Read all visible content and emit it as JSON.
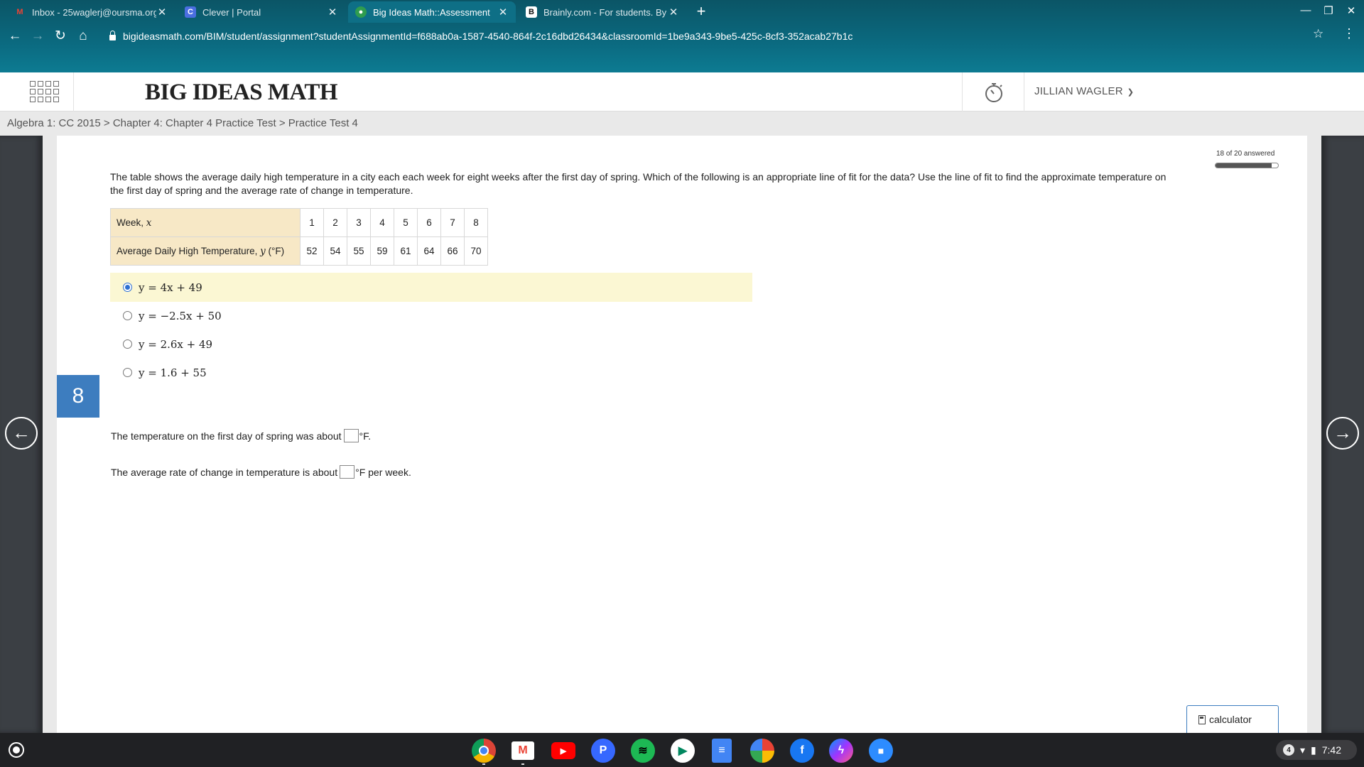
{
  "browser": {
    "tabs": [
      {
        "title": "Inbox - 25waglerj@oursma.org",
        "favicon": "gmail-icon"
      },
      {
        "title": "Clever | Portal",
        "favicon": "clever-icon"
      },
      {
        "title": "Big Ideas Math::Assessment",
        "favicon": "bigideas-icon",
        "active": true
      },
      {
        "title": "Brainly.com - For students. By st",
        "favicon": "brainly-icon"
      }
    ],
    "url": "bigideasmath.com/BIM/student/assignment?studentAssignmentId=f688ab0a-1587-4540-864f-2c16dbd26434&classroomId=1be9a343-9be5-425c-8cf3-352acab27b1c"
  },
  "header": {
    "logo": "BIG IDEAS MATH",
    "user": "JILLIAN WAGLER"
  },
  "breadcrumb": "Algebra 1: CC 2015 > Chapter 4: Chapter 4 Practice Test > Practice Test 4",
  "progress": {
    "label": "18 of 20 answered",
    "answered": 18,
    "total": 20
  },
  "question": {
    "number": "8",
    "text": "The table shows the average daily high temperature in a city each each week for eight weeks after the first day of spring. Which of the following is an appropriate line of fit for the data? Use the line of fit to find the approximate temperature on the first day of spring and the average rate of change in temperature.",
    "table": {
      "row1_label": "Week, ",
      "row1_var": "x",
      "row2_label": "Average Daily High Temperature, ",
      "row2_var": "y",
      "row2_unit": " (°F)",
      "weeks": [
        "1",
        "2",
        "3",
        "4",
        "5",
        "6",
        "7",
        "8"
      ],
      "temps": [
        "52",
        "54",
        "55",
        "59",
        "61",
        "64",
        "66",
        "70"
      ]
    },
    "choices": [
      {
        "label": "y = 4x + 49",
        "selected": true
      },
      {
        "label": "y = −2.5x + 50",
        "selected": false
      },
      {
        "label": "y = 2.6x + 49",
        "selected": false
      },
      {
        "label": "y = 1.6 + 55",
        "selected": false
      }
    ],
    "fill1": {
      "before": "The temperature on the first day of spring was about ",
      "after": "°F."
    },
    "fill2": {
      "before": "The average rate of change in temperature is about ",
      "after": "°F per week."
    }
  },
  "calculator_label": "calculator",
  "shelf": {
    "apps": [
      "chrome-icon",
      "gmail-icon",
      "youtube-icon",
      "pandora-icon",
      "spotify-icon",
      "play-store-icon",
      "docs-icon",
      "photos-icon",
      "facebook-icon",
      "messenger-icon",
      "zoom-icon"
    ],
    "notification_count": "4",
    "time": "7:42"
  },
  "colors": {
    "accent": "#3d7dbf",
    "chrome": "#0b6a80",
    "selected_choice": "#fbf7d3",
    "table_header": "#f7e8c6"
  }
}
